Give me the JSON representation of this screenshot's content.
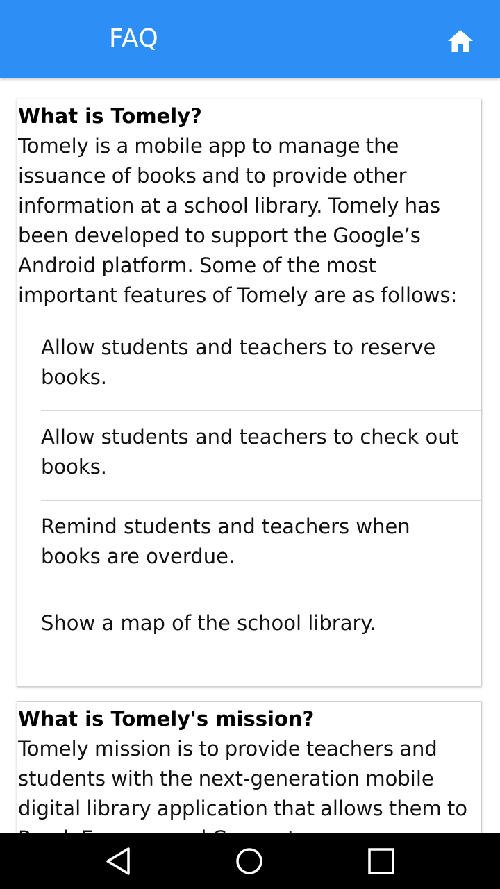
{
  "appbar": {
    "title": "FAQ",
    "home_icon": "home-icon"
  },
  "faq": [
    {
      "question": "What is Tomely?",
      "answer": "Tomely is a mobile app to manage the issuance of books and to provide other information at a school library. Tomely has been developed to support the Google’s Android platform. Some of the most important features of Tomely are as follows:",
      "features": [
        "Allow students and teachers to reserve books.",
        "Allow students and teachers to check out books.",
        "Remind students and teachers when books are overdue.",
        "Show a map of the school library."
      ]
    },
    {
      "question": "What is Tomely's mission?",
      "answer": "Tomely mission is to provide teachers and students with the next-generation mobile digital library application that allows them to Read, Engage, and Connect."
    }
  ],
  "navbar": {
    "back_icon": "back-triangle-icon",
    "home_icon": "home-circle-icon",
    "recents_icon": "recents-square-icon"
  },
  "colors": {
    "appbar": "#2d8ff6",
    "navbar": "#000000"
  }
}
